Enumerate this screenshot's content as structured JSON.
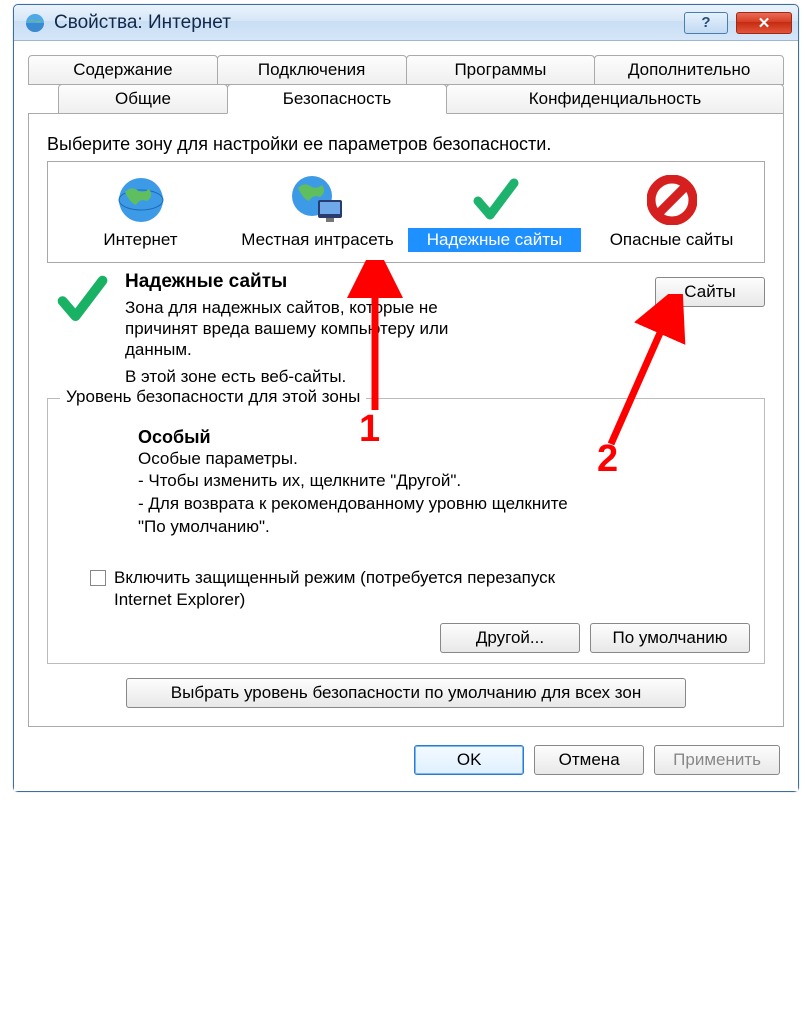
{
  "window": {
    "title": "Свойства: Интернет"
  },
  "tabs": {
    "row1": [
      "Содержание",
      "Подключения",
      "Программы",
      "Дополнительно"
    ],
    "row2": [
      "Общие",
      "Безопасность",
      "Конфиденциальность"
    ]
  },
  "zone_select_heading": "Выберите зону для настройки ее параметров безопасности.",
  "zones": [
    {
      "name": "Интернет"
    },
    {
      "name": "Местная интрасеть"
    },
    {
      "name": "Надежные сайты"
    },
    {
      "name": "Опасные сайты"
    }
  ],
  "zone_desc": {
    "title": "Надежные сайты",
    "body": "Зона для надежных сайтов, которые не причинят вреда вашему компьютеру или данным.",
    "note": "В этой зоне есть веб-сайты.",
    "sites_btn": "Сайты"
  },
  "level_group": {
    "legend": "Уровень безопасности для этой зоны",
    "title": "Особый",
    "line1": "Особые параметры.",
    "line2": "- Чтобы изменить их, щелкните \"Другой\".",
    "line3": "- Для возврата к рекомендованному уровню щелкните \"По умолчанию\"."
  },
  "protected_mode": "Включить защищенный режим (потребуется перезапуск Internet Explorer)",
  "btn_custom": "Другой...",
  "btn_default_level": "По умолчанию",
  "btn_reset_all": "Выбрать уровень безопасности по умолчанию для всех зон",
  "btn_ok": "OK",
  "btn_cancel": "Отмена",
  "btn_apply": "Применить",
  "annotations": {
    "one": "1",
    "two": "2"
  }
}
